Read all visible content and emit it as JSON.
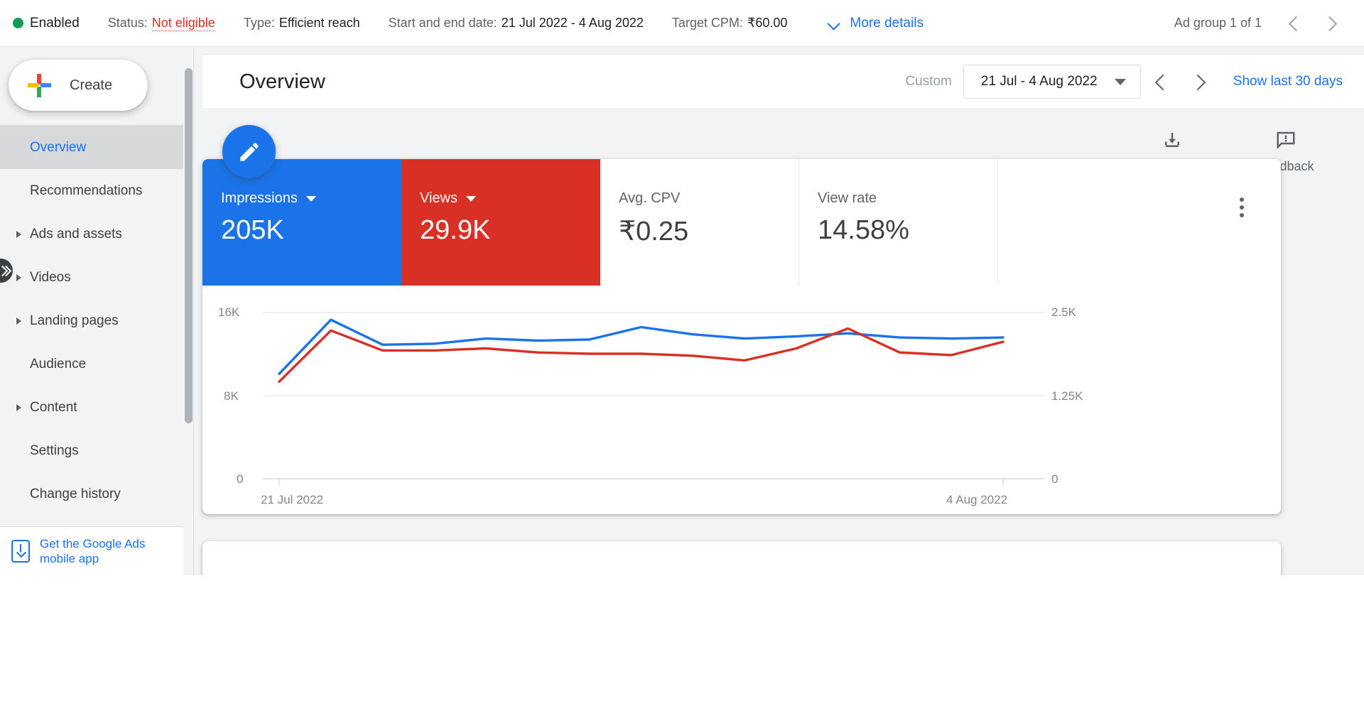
{
  "topbar": {
    "status_indicator": "Enabled",
    "items": [
      {
        "label": "Status:",
        "value": "Not eligible",
        "danger": true
      },
      {
        "label": "Type:",
        "value": "Efficient reach",
        "danger": false
      },
      {
        "label": "Start and end date:",
        "value": "21 Jul 2022 - 4 Aug 2022",
        "danger": false
      },
      {
        "label": "Target CPM:",
        "value": "₹60.00",
        "danger": false
      }
    ],
    "more_details": "More details",
    "ad_group_count": "Ad group 1 of 1",
    "prev_icon": "chevron-left-icon",
    "next_icon": "chevron-right-icon"
  },
  "sidebar": {
    "create_label": "Create",
    "items": [
      {
        "label": "Overview",
        "expandable": false,
        "active": true
      },
      {
        "label": "Recommendations",
        "expandable": false,
        "active": false
      },
      {
        "label": "Ads and assets",
        "expandable": true,
        "active": false
      },
      {
        "label": "Videos",
        "expandable": true,
        "active": false
      },
      {
        "label": "Landing pages",
        "expandable": true,
        "active": false
      },
      {
        "label": "Audience",
        "expandable": false,
        "active": false
      },
      {
        "label": "Content",
        "expandable": true,
        "active": false
      },
      {
        "label": "Settings",
        "expandable": false,
        "active": false
      },
      {
        "label": "Change history",
        "expandable": false,
        "active": false
      }
    ],
    "promo": "Get the Google Ads mobile app"
  },
  "header": {
    "title": "Overview",
    "custom_label": "Custom",
    "date_range": "21 Jul - 4 Aug 2022",
    "show_last_30_days": "Show last 30 days"
  },
  "toolbar": {
    "edit_icon": "pencil-icon",
    "download_label": "Download",
    "feedback_label": "Feedback"
  },
  "metrics": [
    {
      "label": "Impressions",
      "value": "205K",
      "has_caret": true,
      "color": "#1a73e8"
    },
    {
      "label": "Views",
      "value": "29.9K",
      "has_caret": true,
      "color": "#d93025"
    },
    {
      "label": "Avg. CPV",
      "value": "₹0.25",
      "has_caret": false,
      "color": "#ffffff"
    },
    {
      "label": "View rate",
      "value": "14.58%",
      "has_caret": false,
      "color": "#ffffff"
    }
  ],
  "chart_data": {
    "type": "line",
    "title": "",
    "xlabel": "",
    "ylabel": "",
    "grid": true,
    "legend": "none",
    "x_tick_labels": [
      "21 Jul 2022",
      "4 Aug 2022"
    ],
    "x": [
      "21 Jul 2022",
      "22 Jul 2022",
      "23 Jul 2022",
      "24 Jul 2022",
      "25 Jul 2022",
      "26 Jul 2022",
      "27 Jul 2022",
      "28 Jul 2022",
      "29 Jul 2022",
      "30 Jul 2022",
      "31 Jul 2022",
      "1 Aug 2022",
      "2 Aug 2022",
      "3 Aug 2022",
      "4 Aug 2022"
    ],
    "left_axis": {
      "name": "Impressions",
      "ticks": [
        "0",
        "8K",
        "16K"
      ],
      "tick_values": [
        0,
        8000,
        16000
      ],
      "ylim": [
        0,
        16000
      ]
    },
    "right_axis": {
      "name": "Views",
      "ticks": [
        "0",
        "1.25K",
        "2.5K"
      ],
      "tick_values": [
        0,
        1250,
        2500
      ],
      "ylim": [
        0,
        2500
      ]
    },
    "series": [
      {
        "name": "Impressions",
        "color": "#1a73e8",
        "axis": "left",
        "values": [
          10100,
          15300,
          12900,
          13000,
          13500,
          13300,
          13400,
          14600,
          13900,
          13500,
          13700,
          14000,
          13600,
          13500,
          13600
        ]
      },
      {
        "name": "Views",
        "color": "#d93025",
        "axis": "right",
        "values": [
          1460,
          2230,
          1930,
          1930,
          1960,
          1900,
          1880,
          1880,
          1850,
          1780,
          1960,
          2260,
          1900,
          1860,
          2060
        ]
      }
    ]
  }
}
